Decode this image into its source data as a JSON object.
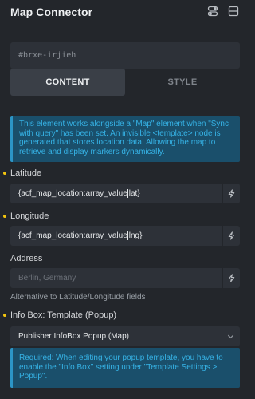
{
  "header": {
    "title": "Map Connector",
    "icons": [
      "switch-icon",
      "layers-icon"
    ]
  },
  "css_id": {
    "value": "#brxe-irjieh"
  },
  "tabs": [
    {
      "label": "CONTENT",
      "active": true
    },
    {
      "label": "STYLE",
      "active": false
    }
  ],
  "info_top": {
    "text": "This element works alongside a \"Map\" element when \"Sync with query\" has been set. An invisible <template> node is generated that stores location data. Allowing the map to retrieve and display markers dynamically."
  },
  "latitude": {
    "label": "Latitude",
    "value_before_caret": "{acf_map_location:array_value",
    "value_after_caret": "lat}"
  },
  "longitude": {
    "label": "Longitude",
    "value_before_caret": "{acf_map_location:array_value",
    "value_after_caret": "lng}"
  },
  "address": {
    "label": "Address",
    "placeholder": "Berlin, Germany",
    "hint": "Alternative to Latitude/Longitude fields"
  },
  "infobox": {
    "label": "Info Box: Template (Popup)",
    "selected": "Publisher InfoBox Popup (Map)"
  },
  "info_bottom": {
    "text": "Required: When editing your popup template, you have to enable the \"Info Box\" setting under \"Template Settings > Popup\"."
  },
  "colors": {
    "background": "#23262b",
    "input_bg": "#2d3138",
    "info_bg": "#1a4f6b",
    "info_text": "#36b3e6",
    "required_dot": "#f1c40f"
  }
}
